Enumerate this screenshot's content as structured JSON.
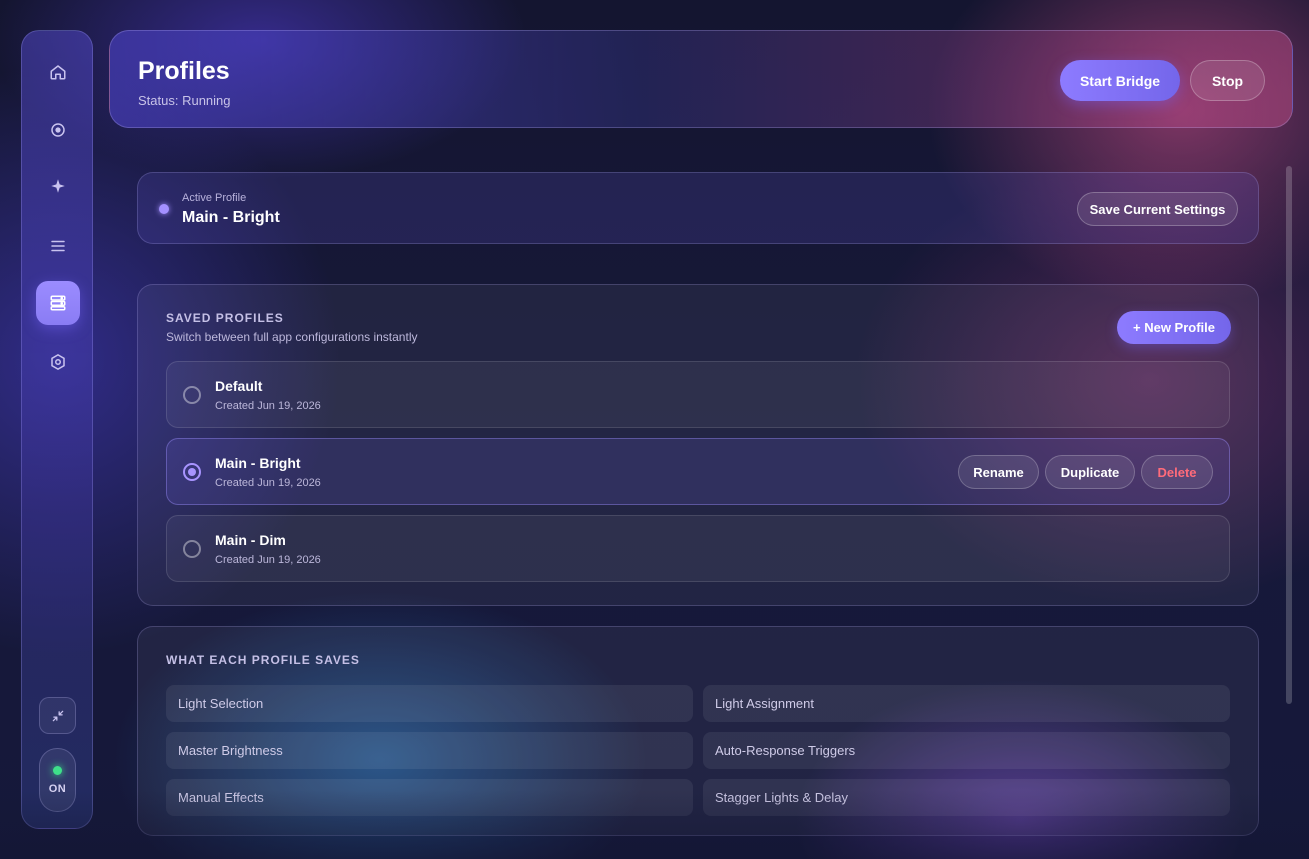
{
  "sidebar": {
    "nav": [
      {
        "icon": "home-icon",
        "active": false
      },
      {
        "icon": "target-icon",
        "active": false
      },
      {
        "icon": "sparkle-icon",
        "active": false
      },
      {
        "icon": "menu-icon",
        "active": false
      },
      {
        "icon": "server-icon",
        "active": true
      },
      {
        "icon": "settings-icon",
        "active": false
      }
    ],
    "power_label": "ON",
    "power_color": "#3ee08a"
  },
  "header": {
    "title": "Profiles",
    "status": "Status: Running",
    "start_label": "Start Bridge",
    "stop_label": "Stop"
  },
  "active_profile": {
    "label": "Active Profile",
    "name": "Main - Bright",
    "save_label": "Save Current Settings"
  },
  "saved_profiles": {
    "title": "SAVED PROFILES",
    "subtitle": "Switch between full app configurations instantly",
    "new_label": "+ New Profile",
    "items": [
      {
        "name": "Default",
        "created": "Created Jun 19, 2026",
        "selected": false
      },
      {
        "name": "Main - Bright",
        "created": "Created Jun 19, 2026",
        "selected": true
      },
      {
        "name": "Main - Dim",
        "created": "Created Jun 19, 2026",
        "selected": false
      }
    ],
    "actions": {
      "rename": "Rename",
      "duplicate": "Duplicate",
      "delete": "Delete"
    }
  },
  "profile_saves": {
    "title": "WHAT EACH PROFILE SAVES",
    "items": [
      "Light Selection",
      "Light Assignment",
      "Master Brightness",
      "Auto-Response Triggers",
      "Manual Effects",
      "Stagger Lights & Delay"
    ]
  },
  "colors": {
    "accent": "#8d7bff",
    "danger": "#ff6b7a",
    "online": "#3ee08a"
  }
}
